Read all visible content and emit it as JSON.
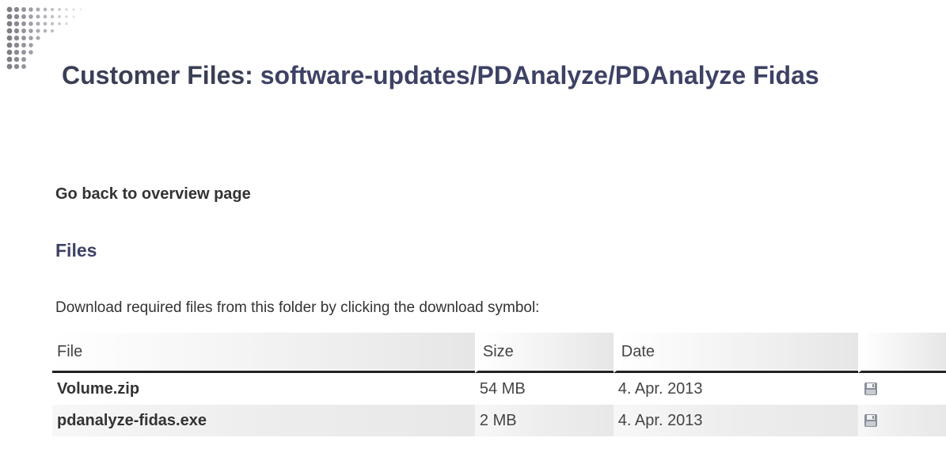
{
  "header": {
    "title_prefix": "Customer Files:",
    "title_path": "software-updates/PDAnalyze/PDAnalyze Fidas"
  },
  "nav": {
    "back_link": "Go back to overview page"
  },
  "files_section": {
    "heading": "Files",
    "instructions": "Download required files from this folder by clicking the download symbol:",
    "columns": [
      "File",
      "Size",
      "Date"
    ],
    "rows": [
      {
        "name": "Volume.zip",
        "size": "54 MB",
        "date": "4. Apr. 2013",
        "icon": "floppy-disk-icon"
      },
      {
        "name": "pdanalyze-fidas.exe",
        "size": "2 MB",
        "date": "4. Apr. 2013",
        "icon": "floppy-disk-icon"
      }
    ]
  },
  "colors": {
    "heading": "#3d4265",
    "text": "#333333",
    "rule": "#222222"
  }
}
